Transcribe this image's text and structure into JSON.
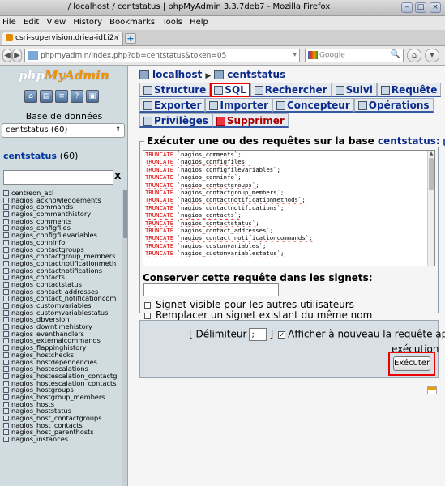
{
  "window": {
    "title_path": "/ localhost / centstatus | phpMyAdmin 3.3.7deb7 - Mozilla Firefox",
    "min_label": "–",
    "max_label": "□",
    "close_label": "×"
  },
  "menubar": [
    "File",
    "Edit",
    "View",
    "History",
    "Bookmarks",
    "Tools",
    "Help"
  ],
  "tab": {
    "label": "csri-supervision.driea-idf.i2 / lo...",
    "close": "×",
    "new_tab": "+"
  },
  "nav": {
    "back": "◀",
    "forward": "▶",
    "url": "phpmyadmin/index.php?db=centstatus&token=05",
    "search_placeholder": "Google",
    "search_engine": "G",
    "search_icon": "🔍",
    "home": "⌂",
    "menu": "▾"
  },
  "sidebar": {
    "logo_php": "php",
    "logo_my": "MyAdmin",
    "db_label": "Base de données",
    "db_select": "centstatus (60)",
    "db_title": "centstatus",
    "db_count": "(60)",
    "filter_value": "",
    "filter_clear": "X",
    "tables": [
      "centreon_acl",
      "nagios_acknowledgements",
      "nagios_commands",
      "nagios_commenthistory",
      "nagios_comments",
      "nagios_configfiles",
      "nagios_configfilevariables",
      "nagios_conninfo",
      "nagios_contactgroups",
      "nagios_contactgroup_members",
      "nagios_contactnotificationmeth",
      "nagios_contactnotifications",
      "nagios_contacts",
      "nagios_contactstatus",
      "nagios_contact_addresses",
      "nagios_contact_notificationcom",
      "nagios_customvariables",
      "nagios_customvariablestatus",
      "nagios_dbversion",
      "nagios_downtimehistory",
      "nagios_eventhandlers",
      "nagios_externalcommands",
      "nagios_flappinghistory",
      "nagios_hostchecks",
      "nagios_hostdependencies",
      "nagios_hostescalations",
      "nagios_hostescalation_contactg",
      "nagios_hostescalation_contacts",
      "nagios_hostgroups",
      "nagios_hostgroup_members",
      "nagios_hosts",
      "nagios_hoststatus",
      "nagios_host_contactgroups",
      "nagios_host_contacts",
      "nagios_host_parenthosts",
      "nagios_instances"
    ]
  },
  "breadcrumb": {
    "server": "localhost",
    "separator": "▶",
    "database": "centstatus"
  },
  "tabs": {
    "row1": [
      "Structure",
      "SQL",
      "Rechercher",
      "Suivi",
      "Requête"
    ],
    "row2": [
      "Exporter",
      "Importer",
      "Concepteur",
      "Opérations"
    ],
    "row3": [
      "Privilèges",
      "Supprimer"
    ]
  },
  "query": {
    "legend_prefix": "Exécuter une ou des requêtes sur la base",
    "legend_db": "centstatus:",
    "help": "?",
    "keyword": "TRUNCATE",
    "lines": [
      "`nagios_comments`;",
      "`nagios_configfiles`;",
      "`nagios_configfilevariables`;",
      "`nagios_conninfo`;",
      "`nagios_contactgroups`;",
      "`nagios_contactgroup_members`;",
      "`nagios_contactnotificationmethods`;",
      "`nagios_contactnotifications`;",
      "`nagios_contacts`;",
      "`nagios_contactstatus`;",
      "`nagios_contact_addresses`;",
      "`nagios_contact_notificationcommands`;",
      "`nagios_customvariables`;",
      "`nagios_customvariablestatus`;"
    ],
    "scroll_up": "▲"
  },
  "bookmark": {
    "label": "Conserver cette requête dans les signets:",
    "value": "",
    "shared": "Signet visible pour les autres utilisateurs",
    "replace": "Remplacer un signet existant du même nom"
  },
  "footer": {
    "delimiter_label": "[ Délimiteur",
    "delimiter_value": ";",
    "delimiter_close": "]",
    "checkmark": "✓",
    "show_again_1": "Afficher à nouveau la requête après",
    "show_again_2": "exécution",
    "execute": "Exécuter"
  }
}
